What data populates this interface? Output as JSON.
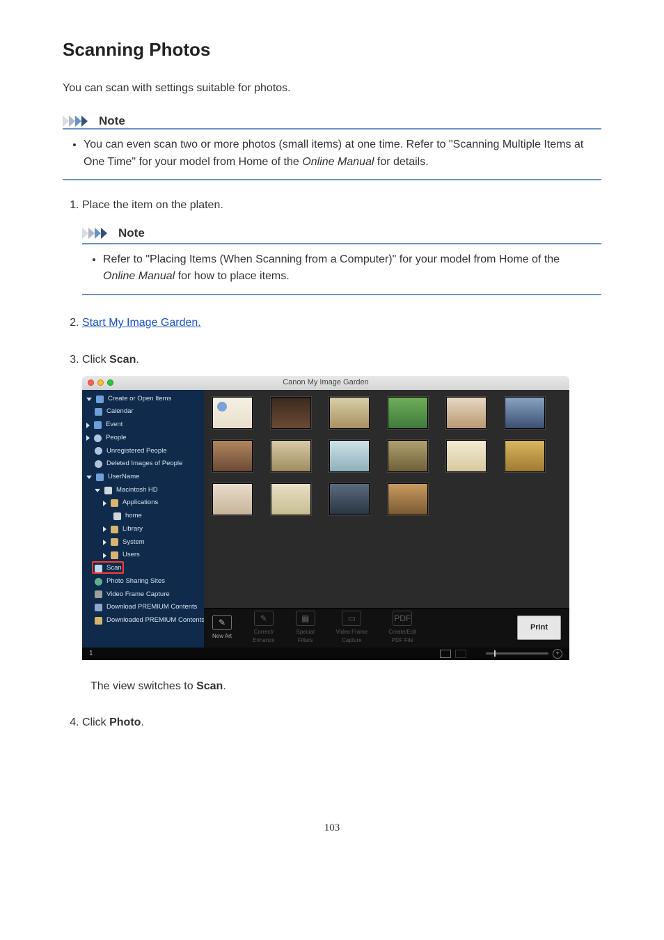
{
  "page": {
    "title": "Scanning Photos",
    "intro": "You can scan with settings suitable for photos.",
    "note_label": "Note",
    "top_note_bullet_a": "You can even scan two or more photos (small items) at one time. Refer to \"Scanning Multiple Items at One Time\" for your model from Home of the ",
    "top_note_bullet_b_em": "Online Manual",
    "top_note_bullet_c": " for details.",
    "steps": {
      "s1_text": "Place the item on the platen.",
      "s1_note_a": "Refer to \"Placing Items (When Scanning from a Computer)\" for your model from Home of the ",
      "s1_note_b_em": "Online Manual",
      "s1_note_c": " for how to place items.",
      "s2_link": "Start My Image Garden.",
      "s3_a": "Click ",
      "s3_b_bold": "Scan",
      "s3_c": ".",
      "s3_after_a": "The view switches to ",
      "s3_after_b_bold": "Scan",
      "s3_after_c": ".",
      "s4_a": "Click ",
      "s4_b_bold": "Photo",
      "s4_c": "."
    },
    "page_number": "103"
  },
  "app": {
    "window_title": "Canon My Image Garden",
    "sidebar": {
      "create_open": "Create or Open Items",
      "calendar": "Calendar",
      "event": "Event",
      "people": "People",
      "unreg": "Unregistered People",
      "deleted": "Deleted Images of People",
      "username": "UserName",
      "mac_hd": "Macintosh HD",
      "applications": "Applications",
      "home": "home",
      "library": "Library",
      "system": "System",
      "users": "Users",
      "scan": "Scan",
      "photo_sharing": "Photo Sharing Sites",
      "video_frame": "Video Frame Capture",
      "download_premium": "Download PREMIUM Contents",
      "downloaded_premium": "Downloaded PREMIUM Contents"
    },
    "bottom": {
      "new_art": "New Art",
      "correct": "Correct/\nEnhance",
      "filters": "Special\nFilters",
      "video": "Video Frame\nCapture",
      "pdf": "Create/Edit\nPDF File",
      "print": "Print"
    },
    "status_left": "1"
  }
}
